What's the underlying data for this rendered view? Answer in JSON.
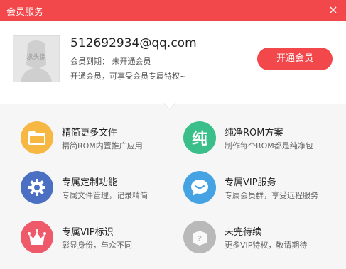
{
  "window": {
    "title": "会员服务",
    "close_label": "×"
  },
  "profile": {
    "avatar_text": "求头像",
    "email": "512692934@qq.com",
    "expire_line": "会员到期： 未开通会员",
    "promo_line": "开通会员，可享受会员专属特权~",
    "open_button": "开通会员"
  },
  "features": [
    {
      "title": "精简更多文件",
      "desc": "精简ROM内置推广应用",
      "icon": "folder-icon",
      "color": "#f6b843"
    },
    {
      "title": "纯净ROM方案",
      "desc": "制作每个ROM都是纯净包",
      "icon": "pure-icon",
      "glyph": "纯",
      "color": "#3bbf8a"
    },
    {
      "title": "专属定制功能",
      "desc": "专属文件管理，记录精简",
      "icon": "gear-icon",
      "color": "#4a6fc3"
    },
    {
      "title": "专属VIP服务",
      "desc": "专属会员群，享受远程服务",
      "icon": "chat-icon",
      "color": "#45a3e3"
    },
    {
      "title": "专属VIP标识",
      "desc": "彰显身份，与众不同",
      "icon": "crown-icon",
      "color": "#ef5a6a"
    },
    {
      "title": "未完待续",
      "desc": "更多VIP特权，敬请期待",
      "icon": "mystery-box-icon",
      "glyph": "?",
      "color": "#b9b9b9"
    }
  ],
  "colors": {
    "brand": "#f2484b",
    "panel": "#f6f6f6"
  }
}
